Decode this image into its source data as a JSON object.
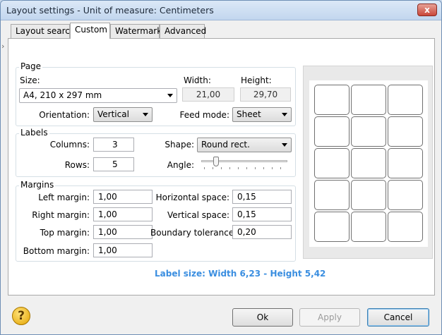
{
  "window": {
    "title": "Layout settings - Unit of measure: Centimeters",
    "close_glyph": "x"
  },
  "tabs": [
    {
      "label": "Layout search"
    },
    {
      "label": "Custom"
    },
    {
      "label": "Watermark"
    },
    {
      "label": "Advanced"
    }
  ],
  "page_group": {
    "title": "Page",
    "size_label": "Size:",
    "size_value": "A4, 210 x 297 mm",
    "width_label": "Width:",
    "width_value": "21,00",
    "height_label": "Height:",
    "height_value": "29,70",
    "orientation_label": "Orientation:",
    "orientation_value": "Vertical",
    "feed_mode_label": "Feed mode:",
    "feed_mode_value": "Sheet"
  },
  "labels_group": {
    "title": "Labels",
    "columns_label": "Columns:",
    "columns_value": "3",
    "rows_label": "Rows:",
    "rows_value": "5",
    "shape_label": "Shape:",
    "shape_value": "Round rect.",
    "angle_label": "Angle:",
    "angle_level": 0.15
  },
  "margins_group": {
    "title": "Margins",
    "left_label": "Left margin:",
    "left_value": "1,00",
    "right_label": "Right margin:",
    "right_value": "1,00",
    "top_label": "Top margin:",
    "top_value": "1,00",
    "bottom_label": "Bottom margin:",
    "bottom_value": "1,00",
    "hspace_label": "Horizontal space:",
    "hspace_value": "0,15",
    "vspace_label": "Vertical space:",
    "vspace_value": "0,15",
    "tolerance_label": "Boundary tolerance:",
    "tolerance_value": "0,20"
  },
  "preview": {
    "columns": 3,
    "rows": 5
  },
  "label_size_text": "Label size: Width 6,23 - Height 5,42",
  "buttons": {
    "ok": "Ok",
    "apply": "Apply",
    "cancel": "Cancel",
    "help_glyph": "?"
  },
  "colors": {
    "label_size_text": "#3a8ee0",
    "titlebar": "#c2d6ee"
  }
}
